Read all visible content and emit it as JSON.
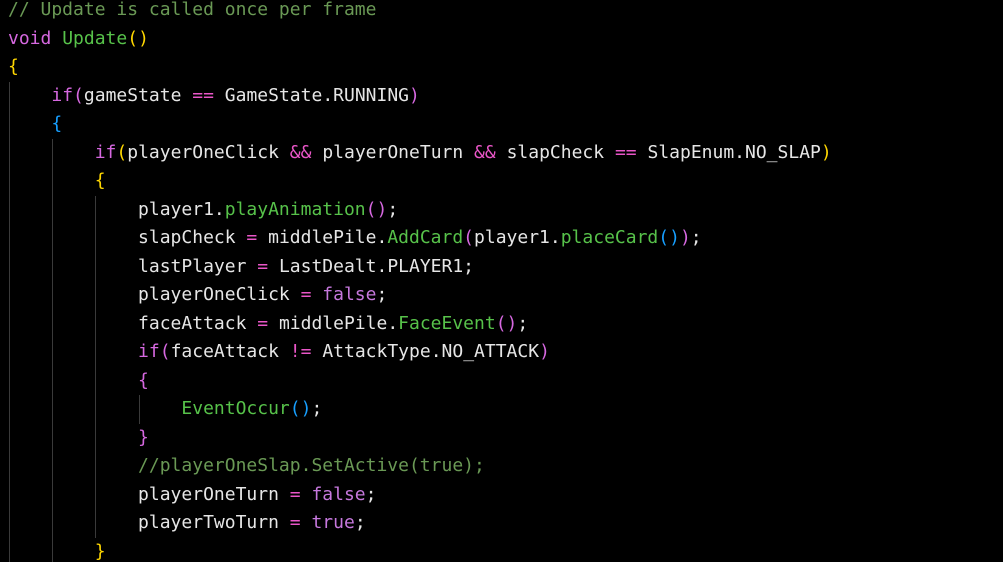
{
  "colors": {
    "background": "#000000",
    "comment": "#6a9955",
    "keyword": "#d668e0",
    "function": "#57c24a",
    "identifier": "#e6e6e6",
    "operator": "#ea56c8",
    "bracket_level1": "#ffd700",
    "bracket_level2": "#d668e0",
    "bracket_level3": "#179fff",
    "indent_guide": "#3a3a3a"
  },
  "code": {
    "lines": [
      {
        "indent": 0,
        "tokens": [
          {
            "t": "// Update is called once per frame",
            "k": "comment"
          }
        ]
      },
      {
        "indent": 0,
        "tokens": [
          {
            "t": "void",
            "k": "keyword"
          },
          {
            "t": " ",
            "k": "plain"
          },
          {
            "t": "Update",
            "k": "fn"
          },
          {
            "t": "()",
            "k": "bracket-1"
          }
        ]
      },
      {
        "indent": 0,
        "tokens": [
          {
            "t": "{",
            "k": "bracket-1"
          }
        ]
      },
      {
        "indent": 1,
        "tokens": [
          {
            "t": "if",
            "k": "keyword"
          },
          {
            "t": "(",
            "k": "bracket-2"
          },
          {
            "t": "gameState ",
            "k": "plain"
          },
          {
            "t": "==",
            "k": "op"
          },
          {
            "t": " GameState.RUNNING",
            "k": "plain"
          },
          {
            "t": ")",
            "k": "bracket-2"
          }
        ]
      },
      {
        "indent": 1,
        "tokens": [
          {
            "t": "{",
            "k": "bracket-3"
          }
        ]
      },
      {
        "indent": 2,
        "tokens": [
          {
            "t": "if",
            "k": "keyword"
          },
          {
            "t": "(",
            "k": "bracket-1"
          },
          {
            "t": "playerOneClick ",
            "k": "plain"
          },
          {
            "t": "&&",
            "k": "op"
          },
          {
            "t": " playerOneTurn ",
            "k": "plain"
          },
          {
            "t": "&&",
            "k": "op"
          },
          {
            "t": " slapCheck ",
            "k": "plain"
          },
          {
            "t": "==",
            "k": "op"
          },
          {
            "t": " SlapEnum.NO_SLAP",
            "k": "plain"
          },
          {
            "t": ")",
            "k": "bracket-1"
          }
        ]
      },
      {
        "indent": 2,
        "tokens": [
          {
            "t": "{",
            "k": "bracket-1"
          }
        ]
      },
      {
        "indent": 3,
        "tokens": [
          {
            "t": "player1.",
            "k": "plain"
          },
          {
            "t": "playAnimation",
            "k": "fn"
          },
          {
            "t": "()",
            "k": "bracket-2"
          },
          {
            "t": ";",
            "k": "plain"
          }
        ]
      },
      {
        "indent": 3,
        "tokens": [
          {
            "t": "slapCheck ",
            "k": "plain"
          },
          {
            "t": "=",
            "k": "op"
          },
          {
            "t": " middlePile.",
            "k": "plain"
          },
          {
            "t": "AddCard",
            "k": "fn"
          },
          {
            "t": "(",
            "k": "bracket-2"
          },
          {
            "t": "player1.",
            "k": "plain"
          },
          {
            "t": "placeCard",
            "k": "fn"
          },
          {
            "t": "()",
            "k": "bracket-3"
          },
          {
            "t": ")",
            "k": "bracket-2"
          },
          {
            "t": ";",
            "k": "plain"
          }
        ]
      },
      {
        "indent": 3,
        "tokens": [
          {
            "t": "lastPlayer ",
            "k": "plain"
          },
          {
            "t": "=",
            "k": "op"
          },
          {
            "t": " LastDealt.PLAYER1;",
            "k": "plain"
          }
        ]
      },
      {
        "indent": 3,
        "tokens": [
          {
            "t": "playerOneClick ",
            "k": "plain"
          },
          {
            "t": "=",
            "k": "op"
          },
          {
            "t": " ",
            "k": "plain"
          },
          {
            "t": "false",
            "k": "bool"
          },
          {
            "t": ";",
            "k": "plain"
          }
        ]
      },
      {
        "indent": 3,
        "tokens": [
          {
            "t": "faceAttack ",
            "k": "plain"
          },
          {
            "t": "=",
            "k": "op"
          },
          {
            "t": " middlePile.",
            "k": "plain"
          },
          {
            "t": "FaceEvent",
            "k": "fn"
          },
          {
            "t": "()",
            "k": "bracket-2"
          },
          {
            "t": ";",
            "k": "plain"
          }
        ]
      },
      {
        "indent": 3,
        "tokens": [
          {
            "t": "if",
            "k": "keyword"
          },
          {
            "t": "(",
            "k": "bracket-2"
          },
          {
            "t": "faceAttack ",
            "k": "plain"
          },
          {
            "t": "!=",
            "k": "op"
          },
          {
            "t": " AttackType.NO_ATTACK",
            "k": "plain"
          },
          {
            "t": ")",
            "k": "bracket-2"
          }
        ]
      },
      {
        "indent": 3,
        "tokens": [
          {
            "t": "{",
            "k": "bracket-2"
          }
        ]
      },
      {
        "indent": 4,
        "tokens": [
          {
            "t": "EventOccur",
            "k": "fn"
          },
          {
            "t": "()",
            "k": "bracket-3"
          },
          {
            "t": ";",
            "k": "plain"
          }
        ]
      },
      {
        "indent": 3,
        "tokens": [
          {
            "t": "}",
            "k": "bracket-2"
          }
        ]
      },
      {
        "indent": 3,
        "tokens": [
          {
            "t": "//playerOneSlap.SetActive(true);",
            "k": "comment"
          }
        ]
      },
      {
        "indent": 3,
        "tokens": [
          {
            "t": "playerOneTurn ",
            "k": "plain"
          },
          {
            "t": "=",
            "k": "op"
          },
          {
            "t": " ",
            "k": "plain"
          },
          {
            "t": "false",
            "k": "bool"
          },
          {
            "t": ";",
            "k": "plain"
          }
        ]
      },
      {
        "indent": 3,
        "tokens": [
          {
            "t": "playerTwoTurn ",
            "k": "plain"
          },
          {
            "t": "=",
            "k": "op"
          },
          {
            "t": " ",
            "k": "plain"
          },
          {
            "t": "true",
            "k": "bool"
          },
          {
            "t": ";",
            "k": "plain"
          }
        ]
      },
      {
        "indent": 2,
        "tokens": [
          {
            "t": "}",
            "k": "bracket-1"
          }
        ]
      }
    ]
  }
}
